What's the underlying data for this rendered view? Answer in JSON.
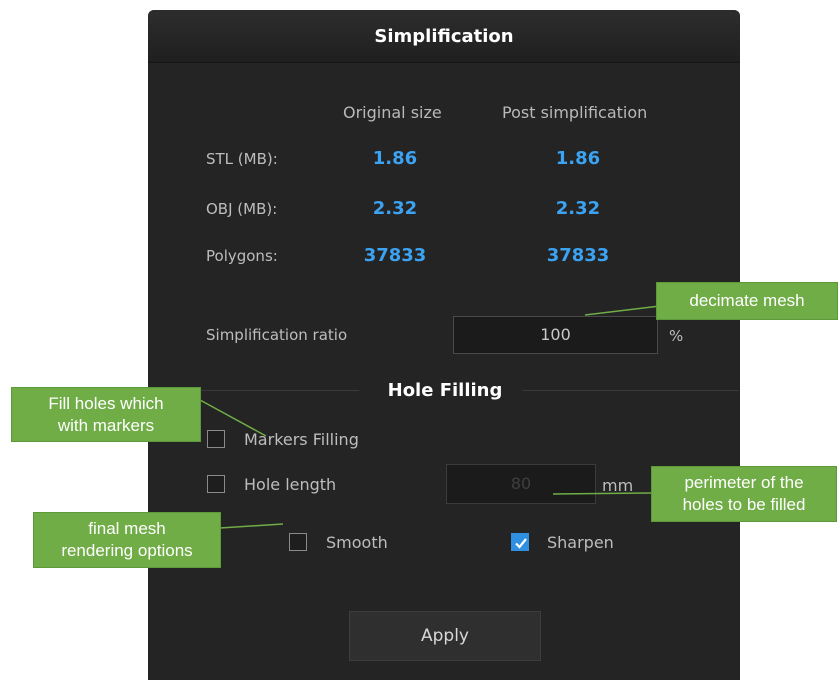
{
  "dialog": {
    "title": "Simplification",
    "columns": {
      "original": "Original size",
      "post": "Post simplification"
    },
    "rows": [
      {
        "label": "STL (MB):",
        "original": "1.86",
        "post": "1.86"
      },
      {
        "label": "OBJ (MB):",
        "original": "2.32",
        "post": "2.32"
      },
      {
        "label": "Polygons:",
        "original": "37833",
        "post": "37833"
      }
    ],
    "ratio": {
      "label": "Simplification ratio",
      "value": "100",
      "unit": "%"
    },
    "hole_filling": {
      "title": "Hole Filling",
      "markers_filling": {
        "label": "Markers Filling",
        "checked": false
      },
      "hole_length": {
        "label": "Hole length",
        "checked": false,
        "value": "80",
        "unit": "mm"
      }
    },
    "render": {
      "smooth": {
        "label": "Smooth",
        "checked": false
      },
      "sharpen": {
        "label": "Sharpen",
        "checked": true
      }
    },
    "apply_label": "Apply"
  },
  "annotations": {
    "decimate": "decimate mesh",
    "fill_holes_1": "Fill holes which",
    "fill_holes_2": "with markers",
    "perimeter_1": "perimeter of the",
    "perimeter_2": "holes to be filled",
    "final_1": "final mesh",
    "final_2": "rendering options"
  },
  "colors": {
    "panel_bg": "#242424",
    "value_blue": "#3ba3f2",
    "check_blue": "#2f8fe0",
    "callout_green": "#70ad47"
  }
}
